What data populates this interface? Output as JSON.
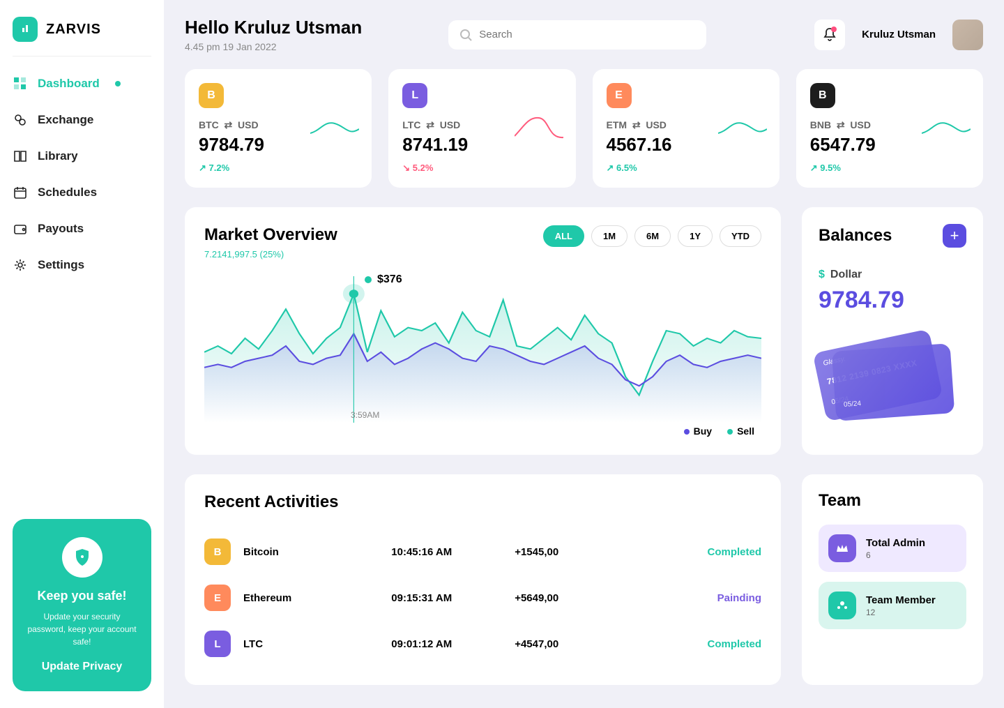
{
  "brand": "ZARVIS",
  "sidebar": {
    "items": [
      "Dashboard",
      "Exchange",
      "Library",
      "Schedules",
      "Payouts",
      "Settings"
    ]
  },
  "safe": {
    "title": "Keep you safe!",
    "sub": "Update your security password, keep your account safe!",
    "btn": "Update Privacy"
  },
  "header": {
    "hello": "Hello Kruluz Utsman",
    "datetime": "4.45 pm 19 Jan 2022",
    "search_placeholder": "Search",
    "username": "Kruluz Utsman"
  },
  "crypto": [
    {
      "sym": "BTC",
      "quote": "USD",
      "value": "9784.79",
      "pct": "7.2%",
      "dir": "up",
      "color": "#f3b938"
    },
    {
      "sym": "LTC",
      "quote": "USD",
      "value": "8741.19",
      "pct": "5.2%",
      "dir": "down",
      "color": "#7a5de0"
    },
    {
      "sym": "ETM",
      "quote": "USD",
      "value": "4567.16",
      "pct": "6.5%",
      "dir": "up",
      "color": "#ff8a5c"
    },
    {
      "sym": "BNB",
      "quote": "USD",
      "value": "6547.79",
      "pct": "9.5%",
      "dir": "up",
      "color": "#1d1d1d"
    }
  ],
  "market": {
    "title": "Market Overview",
    "sub": "7.2141,997.5 (25%)",
    "ranges": [
      "ALL",
      "1M",
      "6M",
      "1Y",
      "YTD"
    ],
    "active_range": "ALL",
    "tooltip": "$376",
    "tooltip_time": "3:59AM",
    "legend_buy": "Buy",
    "legend_sell": "Sell"
  },
  "balances": {
    "title": "Balances",
    "currency": "Dollar",
    "value": "9784.79",
    "card1_num": "7812 2139 0823 XXXX",
    "card1_exp": "05/24",
    "card_brand": "Glassy."
  },
  "recent": {
    "title": "Recent Activities",
    "rows": [
      {
        "name": "Bitcoin",
        "time": "10:45:16 AM",
        "amt": "+1545,00",
        "status": "Completed",
        "st": "c",
        "color": "#f3b938"
      },
      {
        "name": "Ethereum",
        "time": "09:15:31 AM",
        "amt": "+5649,00",
        "status": "Painding",
        "st": "p",
        "color": "#ff8a5c"
      },
      {
        "name": "LTC",
        "time": "09:01:12 AM",
        "amt": "+4547,00",
        "status": "Completed",
        "st": "c",
        "color": "#7a5de0"
      }
    ]
  },
  "team": {
    "title": "Team",
    "items": [
      {
        "label": "Total Admin",
        "count": "6",
        "color": "#7a5de0"
      },
      {
        "label": "Team Member",
        "count": "12",
        "color": "#1fc8a9"
      }
    ]
  },
  "chart_data": {
    "type": "line",
    "series": [
      {
        "name": "Sell",
        "color": "#1fc8a9",
        "values": [
          46,
          50,
          45,
          55,
          48,
          60,
          74,
          58,
          45,
          55,
          62,
          84,
          46,
          73,
          56,
          62,
          60,
          65,
          52,
          72,
          60,
          56,
          80,
          50,
          48,
          55,
          62,
          54,
          70,
          58,
          52,
          30,
          18,
          40,
          60,
          58,
          50,
          55,
          52,
          60,
          56,
          55
        ]
      },
      {
        "name": "Buy",
        "color": "#5b4de0",
        "values": [
          36,
          38,
          36,
          40,
          42,
          44,
          50,
          40,
          38,
          42,
          44,
          58,
          40,
          46,
          38,
          42,
          48,
          52,
          48,
          42,
          40,
          50,
          48,
          44,
          40,
          38,
          42,
          46,
          50,
          42,
          38,
          28,
          24,
          30,
          40,
          44,
          38,
          36,
          40,
          42,
          44,
          42
        ]
      }
    ],
    "highlight_index": 11,
    "highlight_label": "$376",
    "highlight_time": "3:59AM",
    "ylim": [
      0,
      100
    ]
  }
}
